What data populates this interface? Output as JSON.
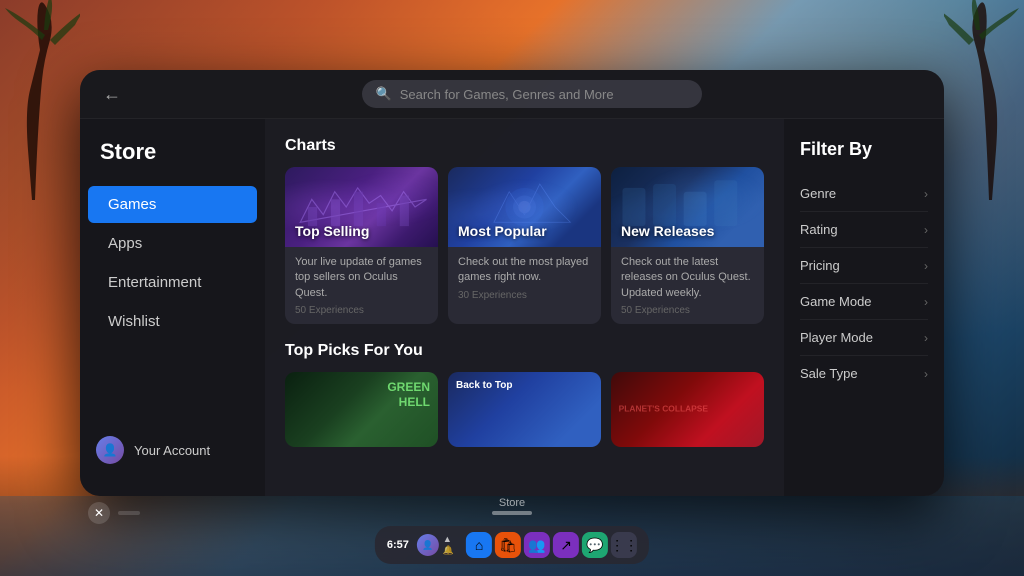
{
  "background": {
    "color_top": "#c0522a",
    "color_bottom": "#1a4060"
  },
  "header": {
    "back_label": "←",
    "search_placeholder": "Search for Games, Genres and More"
  },
  "sidebar": {
    "title": "Store",
    "items": [
      {
        "id": "games",
        "label": "Games",
        "active": true
      },
      {
        "id": "apps",
        "label": "Apps",
        "active": false
      },
      {
        "id": "entertainment",
        "label": "Entertainment",
        "active": false
      },
      {
        "id": "wishlist",
        "label": "Wishlist",
        "active": false
      }
    ],
    "account_label": "Your Account"
  },
  "content": {
    "charts_title": "Charts",
    "charts": [
      {
        "id": "top-selling",
        "label": "Top Selling",
        "description": "Your live update of games top sellers on Oculus Quest.",
        "count": "50 Experiences",
        "theme": "top-selling"
      },
      {
        "id": "most-popular",
        "label": "Most Popular",
        "description": "Check out the most played games right now.",
        "count": "30 Experiences",
        "theme": "most-popular"
      },
      {
        "id": "new-releases",
        "label": "New Releases",
        "description": "Check out the latest releases on Oculus Quest. Updated weekly.",
        "count": "50 Experiences",
        "theme": "new-releases"
      }
    ],
    "picks_title": "Top Picks For You",
    "picks": [
      {
        "id": "green-hell",
        "label": "",
        "theme": "green-hell"
      },
      {
        "id": "back-to-top",
        "label": "",
        "theme": "back-to-top"
      },
      {
        "id": "action",
        "label": "",
        "theme": "action"
      }
    ]
  },
  "filter": {
    "title": "Filter By",
    "items": [
      {
        "id": "genre",
        "label": "Genre"
      },
      {
        "id": "rating",
        "label": "Rating"
      },
      {
        "id": "pricing",
        "label": "Pricing"
      },
      {
        "id": "game-mode",
        "label": "Game Mode"
      },
      {
        "id": "player-mode",
        "label": "Player Mode"
      },
      {
        "id": "sale-type",
        "label": "Sale Type"
      }
    ]
  },
  "taskbar": {
    "time": "6:57",
    "store_label": "Store",
    "icons": [
      {
        "id": "home",
        "symbol": "⌂",
        "color": "blue"
      },
      {
        "id": "store",
        "symbol": "🛍",
        "color": "orange"
      },
      {
        "id": "social",
        "symbol": "👥",
        "color": "purple"
      },
      {
        "id": "arrow",
        "symbol": "↗",
        "color": "purple"
      },
      {
        "id": "chat",
        "symbol": "💬",
        "color": "green"
      },
      {
        "id": "grid",
        "symbol": "⋮⋮",
        "color": "dark"
      }
    ]
  },
  "window_controls": {
    "close_label": "✕",
    "minimize_label": "—"
  }
}
